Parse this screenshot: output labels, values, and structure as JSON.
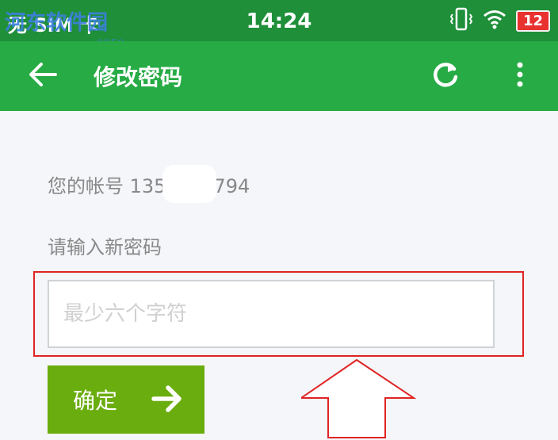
{
  "status_bar": {
    "carrier": "无 SIM 卡",
    "time": "14:24",
    "battery": "12",
    "icons": [
      "vibrate-icon",
      "wifi-icon",
      "battery-icon"
    ]
  },
  "watermark": {
    "text": "河东软件园",
    "url": "www.pc0359.cn"
  },
  "app_bar": {
    "title": "修改密码",
    "icons": [
      "back-arrow-icon",
      "refresh-icon",
      "more-vert-icon"
    ]
  },
  "form": {
    "account_prefix": "您的帐号 135",
    "account_suffix": "794",
    "password_label": "请输入新密码",
    "password_placeholder": "最少六个字符",
    "confirm_label": "确定"
  },
  "colors": {
    "status_bar": "#1f8f3a",
    "app_bar": "#27ab45",
    "confirm_button": "#6aad0e",
    "annotation": "#e02424",
    "battery_low": "#e8322f"
  }
}
